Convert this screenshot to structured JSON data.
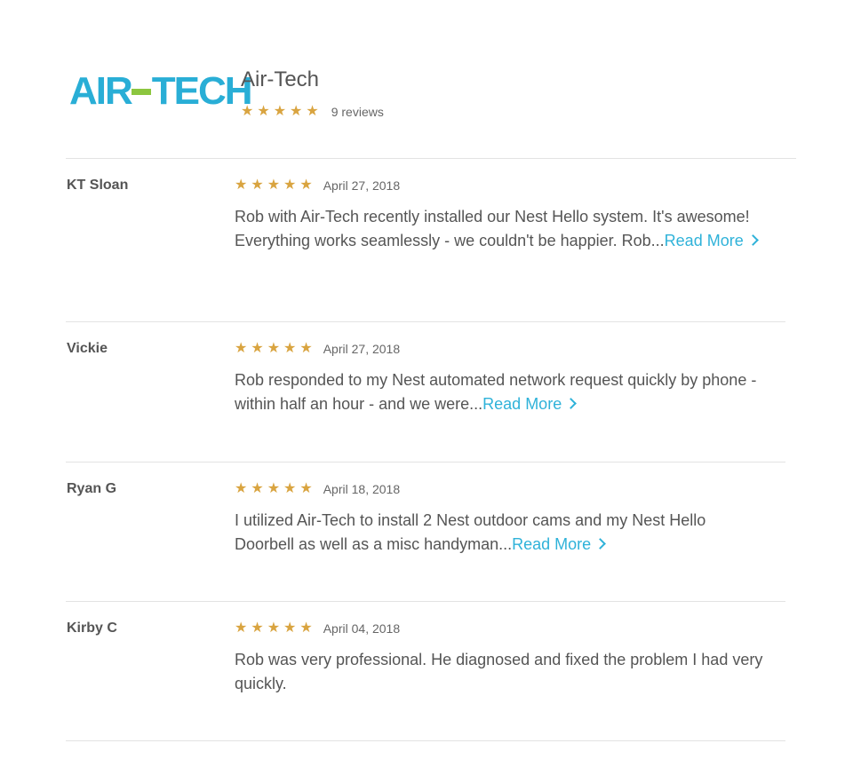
{
  "business": {
    "logo_text_left": "AIR",
    "logo_text_right": "TECH",
    "name": "Air-Tech",
    "stars": "★★★★★",
    "review_count": "9 reviews"
  },
  "colors": {
    "star": "#d9a440",
    "link": "#2fb2d9",
    "logo_blue": "#29aed6",
    "logo_green": "#8cc63f"
  },
  "reviews": [
    {
      "author": "KT Sloan",
      "stars": "★★★★★",
      "date": "April 27, 2018",
      "text": "Rob with Air-Tech recently installed our Nest Hello system. It's awesome! Everything works seamlessly - we couldn't be happier. Rob...",
      "read_more": "Read More"
    },
    {
      "author": "Vickie",
      "stars": "★★★★★",
      "date": "April 27, 2018",
      "text": "Rob responded to my Nest automated network request quickly by phone - within half an hour - and we were...",
      "read_more": "Read More"
    },
    {
      "author": "Ryan G",
      "stars": "★★★★★",
      "date": "April 18, 2018",
      "text": "I utilized Air-Tech to install 2 Nest outdoor cams and my Nest Hello Doorbell as well as a misc handyman...",
      "read_more": "Read More"
    },
    {
      "author": "Kirby C",
      "stars": "★★★★★",
      "date": "April 04, 2018",
      "text": "Rob was very professional. He diagnosed and fixed the problem I had very quickly."
    }
  ]
}
